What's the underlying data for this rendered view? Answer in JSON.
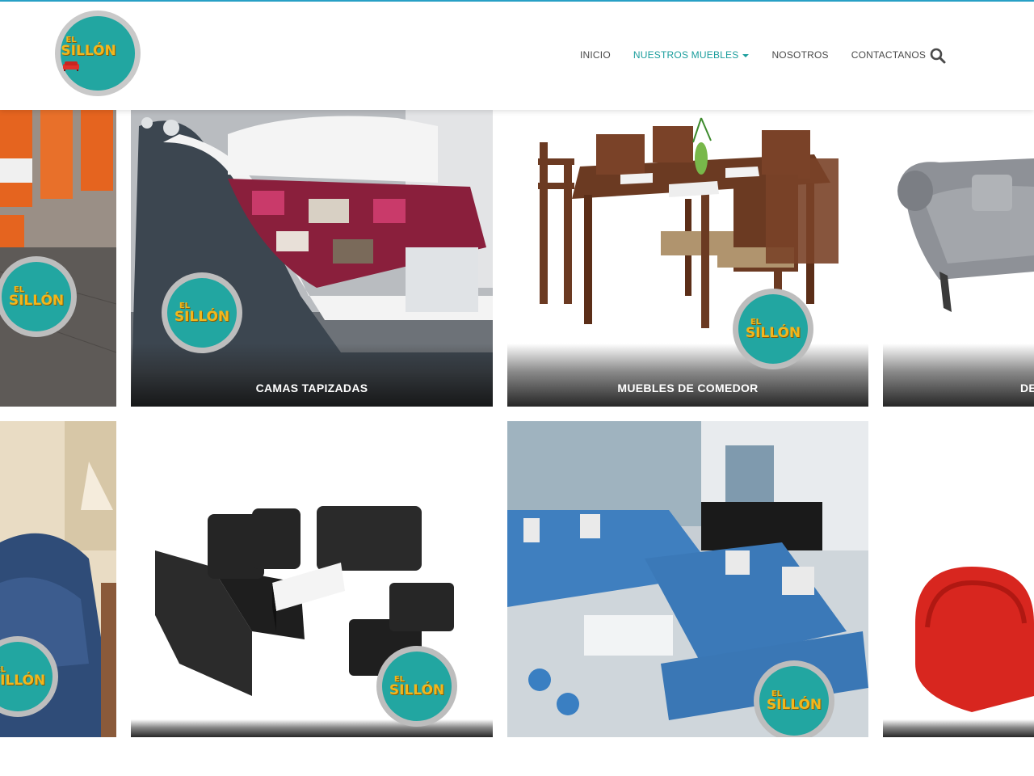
{
  "header": {
    "logo": {
      "line1": "EL",
      "line2": "SILLÓN",
      "icon": "sofa-icon"
    },
    "nav": [
      {
        "label": "INICIO",
        "active": false
      },
      {
        "label": "NUESTROS MUEBLES",
        "active": true,
        "dropdown": true
      },
      {
        "label": "NOSOTROS",
        "active": false
      },
      {
        "label": "CONTACTANOS",
        "active": false
      }
    ],
    "search_icon": "search-icon"
  },
  "colors": {
    "accent": "#1a9d9c",
    "badge_teal": "#22a6a1",
    "logo_yellow": "#f2b61c",
    "top_border": "#29a3c9"
  },
  "cards": [
    {
      "caption": "",
      "photo": "orange restaurant booths"
    },
    {
      "caption": "CAMAS TAPIZADAS",
      "photo": "upholstered bed"
    },
    {
      "caption": "MUEBLES DE COMEDOR",
      "photo": "wooden dining set"
    },
    {
      "caption": "DE",
      "photo": "grey tufted chaise"
    },
    {
      "caption": "",
      "photo": "blue slipcovered sofa"
    },
    {
      "caption": "",
      "photo": "black leather sofa set"
    },
    {
      "caption": "",
      "photo": "blue sectional living room"
    },
    {
      "caption": "",
      "photo": "red ottoman"
    }
  ]
}
